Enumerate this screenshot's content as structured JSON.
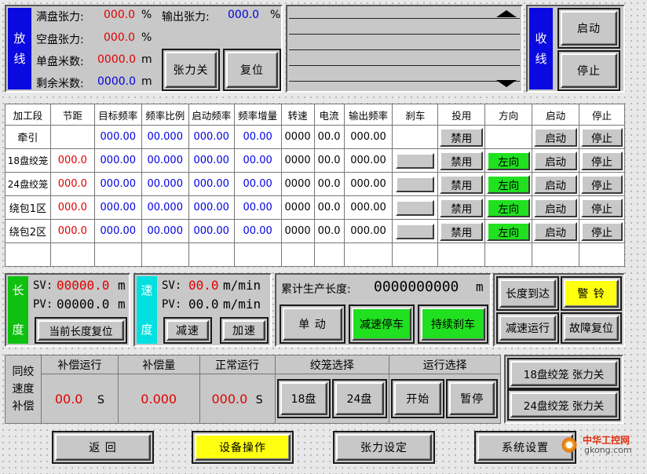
{
  "payoff": {
    "side_label": [
      "放",
      "线"
    ],
    "full_tension_label": "满盘张力:",
    "full_tension_value": "000.0",
    "full_tension_unit": "%",
    "empty_tension_label": "空盘张力:",
    "empty_tension_value": "000.0",
    "empty_tension_unit": "%",
    "single_len_label": "单盘米数:",
    "single_len_value": "0000.0",
    "single_len_unit": "m",
    "remain_len_label": "剩余米数:",
    "remain_len_value": "0000.0",
    "remain_len_unit": "m",
    "output_tension_label": "输出张力:",
    "output_tension_value": "000.0",
    "output_tension_unit": "%",
    "tension_off_btn": "张力关",
    "reset_btn": "复位"
  },
  "takeup": {
    "side_label": [
      "收",
      "线"
    ],
    "start_btn": "启动",
    "stop_btn": "停止"
  },
  "table": {
    "headers": [
      "加工段",
      "节距",
      "目标频率",
      "频率比例",
      "启动频率",
      "频率增量",
      "转速",
      "电流",
      "输出频率",
      "刹车",
      "投用",
      "方向",
      "启动",
      "停止"
    ],
    "rows": [
      {
        "name": "牵引",
        "pitch": "",
        "target": "000.00",
        "ratio": "00.000",
        "start_freq": "000.00",
        "increment": "00.00",
        "speed": "0000",
        "current": "00.0",
        "out_freq": "000.00",
        "brake": false,
        "use": "禁用",
        "dir": "",
        "start": "启动",
        "stop": "停止"
      },
      {
        "name": "18盘绞笼",
        "pitch": "000.0",
        "target": "000.00",
        "ratio": "00.000",
        "start_freq": "000.00",
        "increment": "00.00",
        "speed": "0000",
        "current": "00.0",
        "out_freq": "000.00",
        "brake": true,
        "use": "禁用",
        "dir": "左向",
        "start": "启动",
        "stop": "停止"
      },
      {
        "name": "24盘绞笼",
        "pitch": "000.0",
        "target": "000.00",
        "ratio": "00.000",
        "start_freq": "000.00",
        "increment": "00.00",
        "speed": "0000",
        "current": "00.0",
        "out_freq": "000.00",
        "brake": true,
        "use": "禁用",
        "dir": "左向",
        "start": "启动",
        "stop": "停止"
      },
      {
        "name": "绕包1区",
        "pitch": "000.0",
        "target": "000.00",
        "ratio": "00.000",
        "start_freq": "000.00",
        "increment": "00.00",
        "speed": "0000",
        "current": "00.0",
        "out_freq": "000.00",
        "brake": true,
        "use": "禁用",
        "dir": "左向",
        "start": "启动",
        "stop": "停止"
      },
      {
        "name": "绕包2区",
        "pitch": "000.0",
        "target": "000.00",
        "ratio": "00.000",
        "start_freq": "000.00",
        "increment": "00.00",
        "speed": "0000",
        "current": "00.0",
        "out_freq": "000.00",
        "brake": true,
        "use": "禁用",
        "dir": "左向",
        "start": "启动",
        "stop": "停止"
      }
    ]
  },
  "length": {
    "side_label": [
      "长",
      "度"
    ],
    "sv_label": "SV:",
    "sv_value": "00000.0",
    "sv_unit": "m",
    "pv_label": "PV:",
    "pv_value": "00000.0",
    "pv_unit": "m",
    "reset_btn": "当前长度复位"
  },
  "speed": {
    "side_label": [
      "速",
      "度"
    ],
    "sv_label": "SV:",
    "sv_value": "00.0",
    "sv_unit": "m/min",
    "pv_label": "PV:",
    "pv_value": "00.0",
    "pv_unit": "m/min",
    "dec_btn": "减速",
    "acc_btn": "加速"
  },
  "production": {
    "label": "累计生产长度:",
    "value": "0000000000",
    "unit": "m",
    "jog_btn": "单 动",
    "decel_stop_btn": "减速停车",
    "continuous_brake_btn": "持续刹车"
  },
  "alarm": {
    "length_reached_btn": "长度到达",
    "bell_btn": "警 铃",
    "decel_run_btn": "减速运行",
    "fault_reset_btn": "故障复位"
  },
  "compensation": {
    "side_label": [
      "同绞",
      "速度",
      "补偿"
    ],
    "comp_run_label": "补偿运行",
    "comp_run_value": "00.0",
    "comp_run_unit": "S",
    "comp_amount_label": "补偿量",
    "comp_amount_value": "0.000",
    "normal_run_label": "正常运行",
    "normal_run_value": "000.0",
    "normal_run_unit": "S",
    "cage_select_label": "绞笼选择",
    "cage18_btn": "18盘",
    "cage24_btn": "24盘",
    "run_select_label": "运行选择",
    "start_btn": "开始",
    "pause_btn": "暂停"
  },
  "tension_buttons": {
    "cage18": "18盘绞笼 张力关",
    "cage24": "24盘绞笼 张力关"
  },
  "bottom_nav": {
    "back": "返 回",
    "device_op": "设备操作",
    "tension_set": "张力设定",
    "system_set": "系统设置"
  },
  "watermark": {
    "line1": "中华工控网",
    "line2": "gkong.com"
  },
  "colors": {
    "panel_blue": "#0a0ae0",
    "value_red": "#e00000",
    "value_blue": "#0000e0",
    "active_green": "#20e020",
    "alert_yellow": "#ffff10",
    "length_green": "#10c010",
    "speed_cyan": "#00e0e0"
  }
}
